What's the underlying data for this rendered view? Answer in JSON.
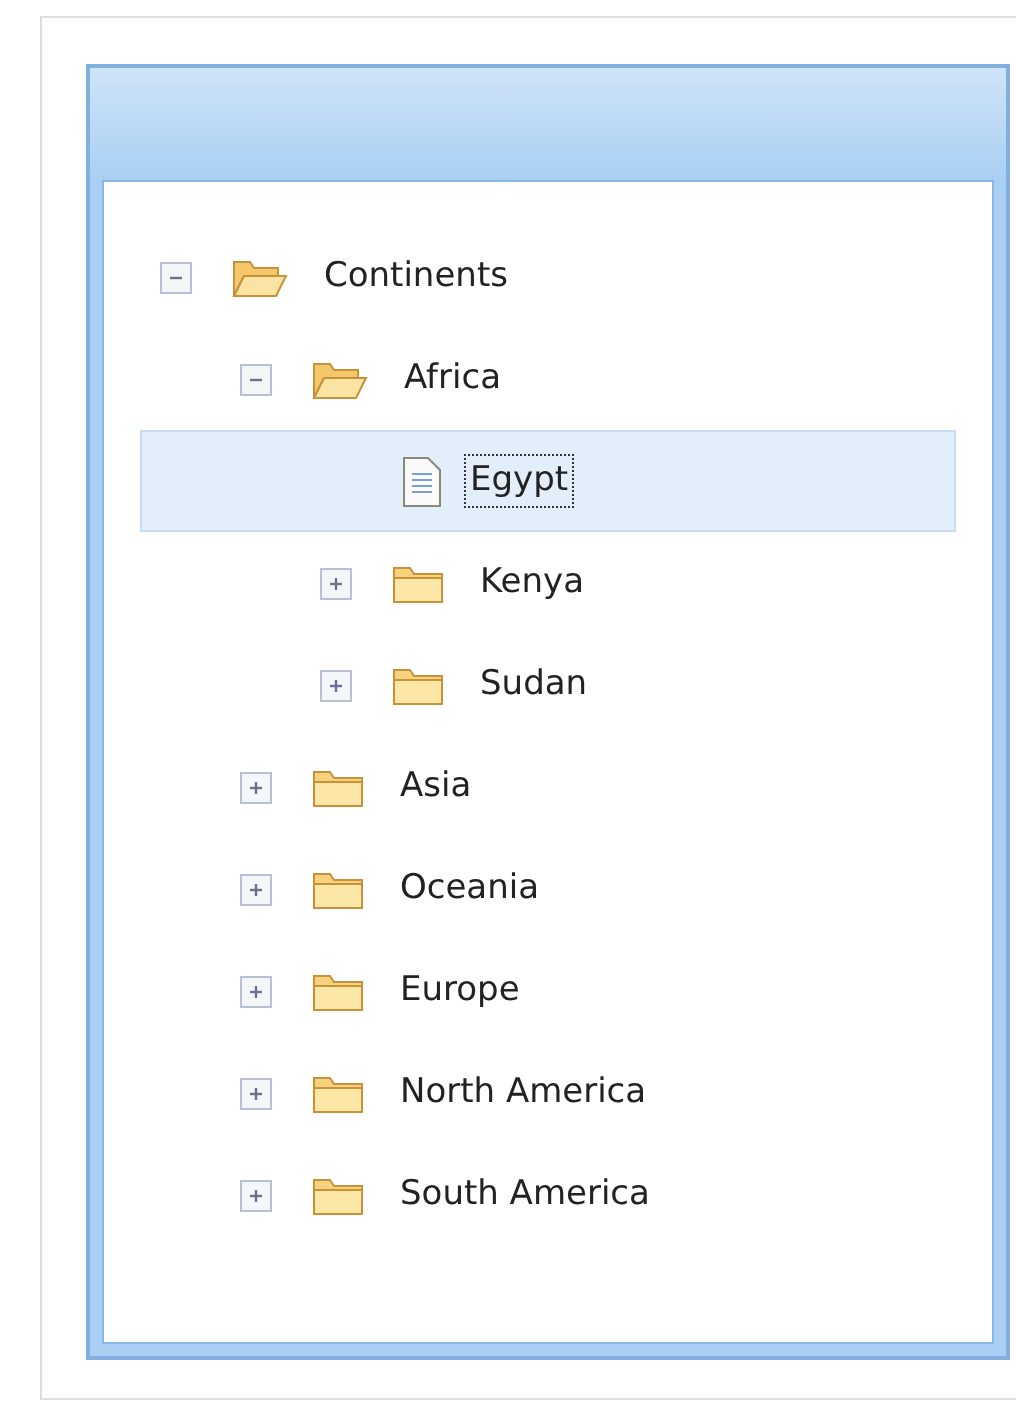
{
  "tree": [
    {
      "label": "Continents",
      "kind": "folder",
      "expanded": true,
      "selected": false,
      "children": [
        {
          "label": "Africa",
          "kind": "folder",
          "expanded": true,
          "selected": false,
          "children": [
            {
              "label": "Egypt",
              "kind": "file",
              "selected": true
            },
            {
              "label": "Kenya",
              "kind": "folder",
              "expanded": false,
              "selected": false
            },
            {
              "label": "Sudan",
              "kind": "folder",
              "expanded": false,
              "selected": false
            }
          ]
        },
        {
          "label": "Asia",
          "kind": "folder",
          "expanded": false,
          "selected": false
        },
        {
          "label": "Oceania",
          "kind": "folder",
          "expanded": false,
          "selected": false
        },
        {
          "label": "Europe",
          "kind": "folder",
          "expanded": false,
          "selected": false
        },
        {
          "label": "North America",
          "kind": "folder",
          "expanded": false,
          "selected": false
        },
        {
          "label": "South America",
          "kind": "folder",
          "expanded": false,
          "selected": false
        }
      ]
    }
  ]
}
